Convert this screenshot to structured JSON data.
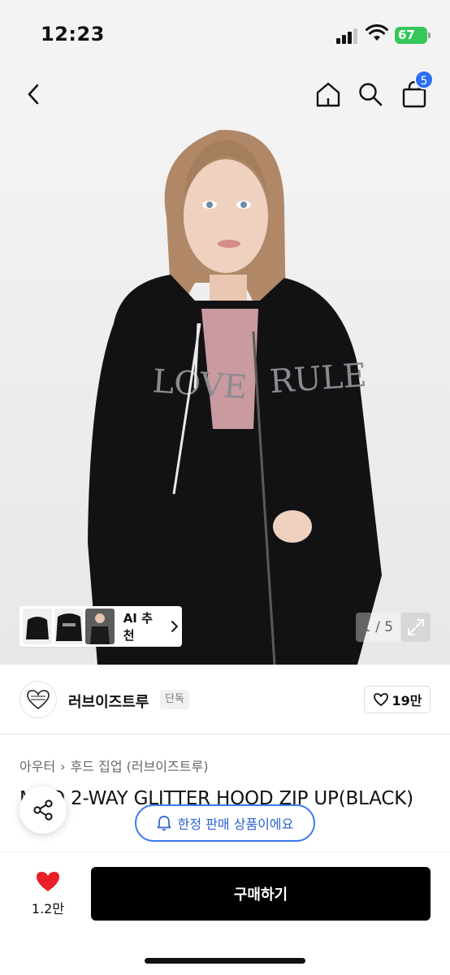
{
  "status": {
    "time": "12:23",
    "battery": "67"
  },
  "nav": {
    "cart_count": "5"
  },
  "gallery": {
    "ai_label": "AI 추천",
    "page": "1 / 5"
  },
  "brand": {
    "name": "러브이즈트루",
    "badge": "단독",
    "likes": "19만"
  },
  "category": {
    "level1": "아우터",
    "level2": "후드 집업 (러브이즈트루)"
  },
  "product": {
    "title": "MILO 2-WAY GLITTER HOOD ZIP UP(BLACK)"
  },
  "notice": {
    "limited_label": "한정 판매 상품이에요"
  },
  "bottom": {
    "heart_count": "1.2만",
    "buy_label": "구매하기"
  },
  "colors": {
    "accent_blue": "#2b6ff2",
    "heart_red": "#e8202a",
    "battery_green": "#34c759"
  }
}
